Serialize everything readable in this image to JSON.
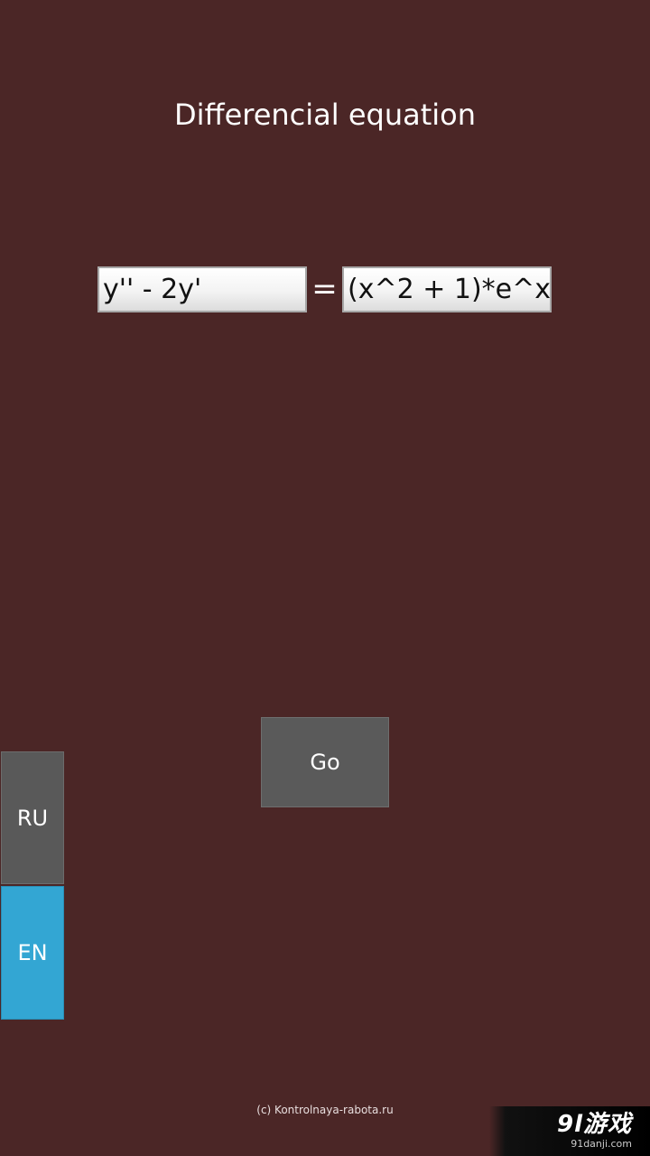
{
  "header": {
    "title": "Differencial equation"
  },
  "equation": {
    "left_value": "y'' - 2y'",
    "equals": "=",
    "right_value": "(x^2 + 1)*e^x"
  },
  "actions": {
    "go_label": "Go"
  },
  "language": {
    "ru_label": "RU",
    "en_label": "EN",
    "selected": "EN"
  },
  "footer": {
    "copyright": "(c) Kontrolnaya-rabota.ru"
  },
  "watermark": {
    "logo_text": "9l游戏",
    "url": "91danji.com"
  },
  "colors": {
    "background": "#4b2626",
    "selected_language": "#33a6d3",
    "button": "#5a5a5a"
  }
}
